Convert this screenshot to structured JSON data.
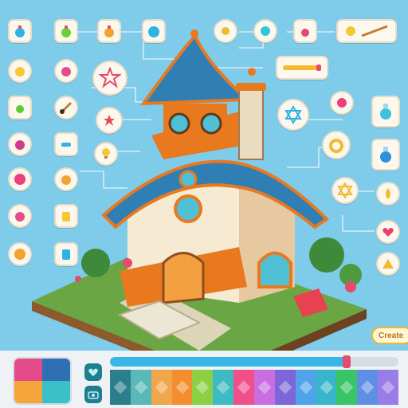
{
  "game": {
    "create_button_label": "Create",
    "progress_value": 0.82,
    "colors": {
      "sky": "#7fcbea",
      "roof_blue": "#2f7fb4",
      "trim_orange": "#e8791f",
      "grass": "#73b54b",
      "accent_pink": "#e44b6c"
    },
    "left_icons": [
      {
        "name": "potion-blue-icon"
      },
      {
        "name": "potion-green-icon"
      },
      {
        "name": "potion-orange-icon"
      },
      {
        "name": "orb-blue-icon"
      },
      {
        "name": "potion-yellow-icon"
      },
      {
        "name": "potion-pink-icon"
      },
      {
        "name": "paintbrush-icon"
      },
      {
        "name": "potion-green-small-icon"
      },
      {
        "name": "paintbrush-2-icon"
      },
      {
        "name": "potion-magenta-icon"
      },
      {
        "name": "eyedropper-icon"
      },
      {
        "name": "orb-pink-icon"
      },
      {
        "name": "potion-orange-2-icon"
      },
      {
        "name": "potion-pink-2-icon"
      },
      {
        "name": "jar-icon"
      },
      {
        "name": "orb-orange-icon"
      },
      {
        "name": "cup-icon"
      }
    ],
    "right_icons": [
      {
        "name": "sun-icon"
      },
      {
        "name": "orb-teal-icon"
      },
      {
        "name": "potion-red-icon"
      },
      {
        "name": "paintbrush-3-icon"
      },
      {
        "name": "pencil-icon"
      },
      {
        "name": "star-of-david-icon"
      },
      {
        "name": "orb-pink-2-icon"
      },
      {
        "name": "potion-teal-icon"
      },
      {
        "name": "ring-icon"
      },
      {
        "name": "potion-blue-2-icon"
      },
      {
        "name": "hexagram-gold-icon"
      },
      {
        "name": "drop-gold-icon"
      },
      {
        "name": "heart-icon"
      },
      {
        "name": "triangle-gold-icon"
      },
      {
        "name": "flower-icon"
      },
      {
        "name": "star-small-icon"
      },
      {
        "name": "bulb-icon"
      }
    ],
    "palette": [
      "#2b7e8c",
      "#58b9b8",
      "#f0a64b",
      "#f28e2f",
      "#8ccf45",
      "#3dbbc2",
      "#f04f8a",
      "#c96ee0",
      "#7c66d9",
      "#4fa3e8",
      "#38b6c9",
      "#39c468",
      "#5f8fe5",
      "#9a7ce6"
    ]
  }
}
